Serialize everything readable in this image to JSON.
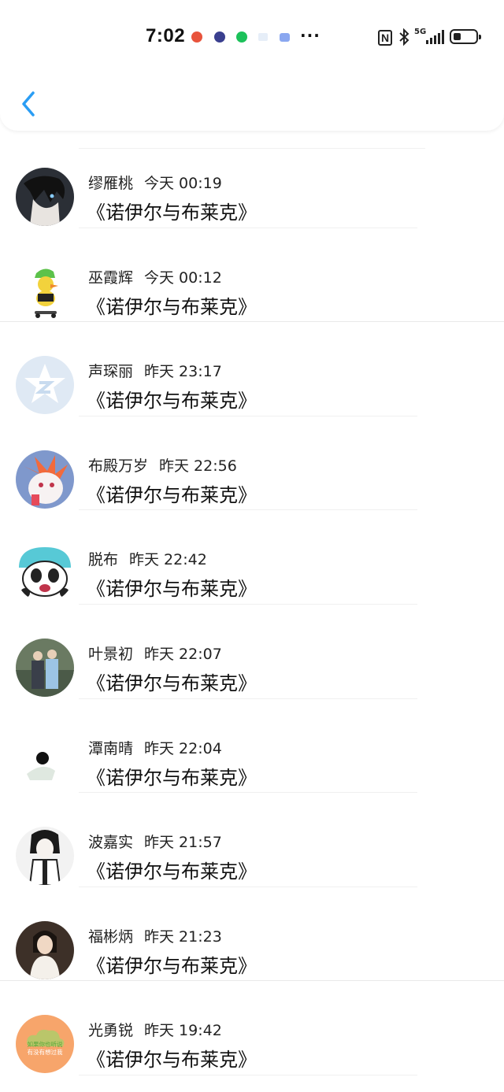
{
  "status_bar": {
    "time": "7:02",
    "more": "···",
    "network": "5G",
    "nfc": "N"
  },
  "items": [
    {
      "name": "缪雁桃",
      "time": "今天 00:19",
      "title": "《诺伊尔与布莱克》",
      "avatar_color": "#2b2f36"
    },
    {
      "name": "巫霞辉",
      "time": "今天 00:12",
      "title": "《诺伊尔与布莱克》",
      "avatar_color": "#f2d23c"
    },
    {
      "name": "声琛丽",
      "time": "昨天 23:17",
      "title": "《诺伊尔与布莱克》",
      "avatar_color": "#cfe0f2"
    },
    {
      "name": "布殿万岁",
      "time": "昨天 22:56",
      "title": "《诺伊尔与布莱克》",
      "avatar_color": "#6f8fc8"
    },
    {
      "name": "脱布",
      "time": "昨天 22:42",
      "title": "《诺伊尔与布莱克》",
      "avatar_color": "#57c9d6"
    },
    {
      "name": "叶景初",
      "time": "昨天 22:07",
      "title": "《诺伊尔与布莱克》",
      "avatar_color": "#4b5a48"
    },
    {
      "name": "潭南晴",
      "time": "昨天 22:04",
      "title": "《诺伊尔与布莱克》",
      "avatar_color": "#e9eee9"
    },
    {
      "name": "波嘉实",
      "time": "昨天 21:57",
      "title": "《诺伊尔与布莱克》",
      "avatar_color": "#2a2a2a"
    },
    {
      "name": "福彬炳",
      "time": "昨天 21:23",
      "title": "《诺伊尔与布莱克》",
      "avatar_color": "#3d3028"
    },
    {
      "name": "光勇锐",
      "time": "昨天 19:42",
      "title": "《诺伊尔与布莱克》",
      "avatar_color": "#f7a56b",
      "avatar_text": "如果你也听说 有没有想过我"
    }
  ]
}
